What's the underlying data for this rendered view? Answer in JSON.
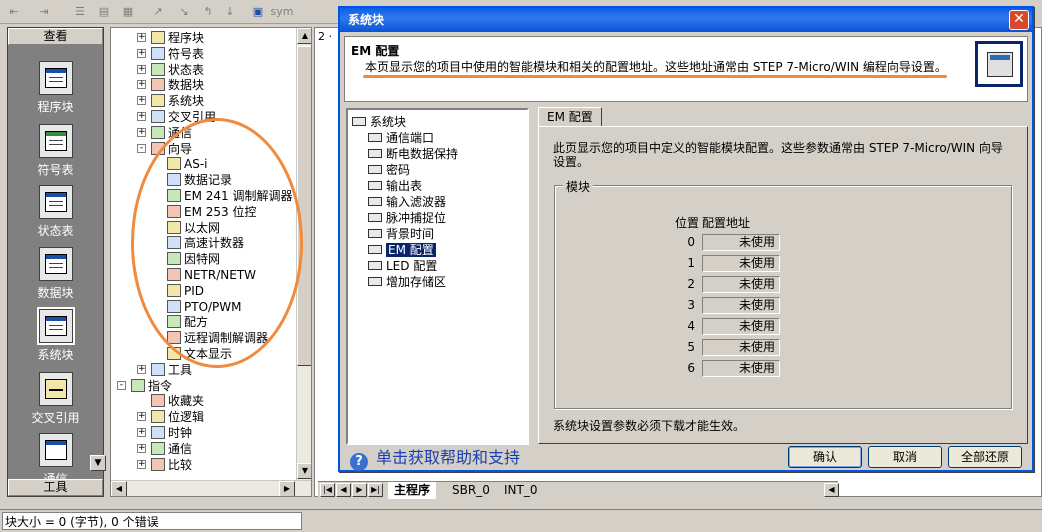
{
  "toolbar": {
    "icons": [
      "indent-icon",
      "outdent-icon",
      "list-icon",
      "table-icon",
      "grid-icon",
      "wire-icon",
      "wire2-icon",
      "arrow-icon",
      "monitor-icon",
      "sym-icon"
    ],
    "sym_label": "sym"
  },
  "viewbar": {
    "header": "查看",
    "footer": "工具",
    "items": [
      {
        "label": "程序块",
        "icon": "program-block-icon"
      },
      {
        "label": "符号表",
        "icon": "symbol-table-icon"
      },
      {
        "label": "状态表",
        "icon": "status-table-icon"
      },
      {
        "label": "数据块",
        "icon": "data-block-icon"
      },
      {
        "label": "系统块",
        "icon": "system-block-icon",
        "selected": true
      },
      {
        "label": "交叉引用",
        "icon": "cross-reference-icon"
      },
      {
        "label": "通信",
        "icon": "communication-icon"
      }
    ]
  },
  "tree": {
    "items": [
      {
        "label": "程序块",
        "level": 1,
        "expander": "+"
      },
      {
        "label": "符号表",
        "level": 1,
        "expander": "+"
      },
      {
        "label": "状态表",
        "level": 1,
        "expander": "+"
      },
      {
        "label": "数据块",
        "level": 1,
        "expander": "+"
      },
      {
        "label": "系统块",
        "level": 1,
        "expander": "+"
      },
      {
        "label": "交叉引用",
        "level": 1,
        "expander": "+"
      },
      {
        "label": "通信",
        "level": 1,
        "expander": "+"
      },
      {
        "label": "向导",
        "level": 1,
        "expander": "-"
      },
      {
        "label": "AS-i",
        "level": 2
      },
      {
        "label": "数据记录",
        "level": 2
      },
      {
        "label": "EM 241 调制解调器",
        "level": 2
      },
      {
        "label": "EM 253 位控",
        "level": 2
      },
      {
        "label": "以太网",
        "level": 2
      },
      {
        "label": "高速计数器",
        "level": 2
      },
      {
        "label": "因特网",
        "level": 2
      },
      {
        "label": "NETR/NETW",
        "level": 2
      },
      {
        "label": "PID",
        "level": 2
      },
      {
        "label": "PTO/PWM",
        "level": 2
      },
      {
        "label": "配方",
        "level": 2
      },
      {
        "label": "远程调制解调器",
        "level": 2
      },
      {
        "label": "文本显示",
        "level": 2
      },
      {
        "label": "工具",
        "level": 1,
        "expander": "+"
      },
      {
        "label": "指令",
        "level": 0,
        "expander": "-"
      },
      {
        "label": "收藏夹",
        "level": 1,
        "expander": ""
      },
      {
        "label": "位逻辑",
        "level": 1,
        "expander": "+"
      },
      {
        "label": "时钟",
        "level": 1,
        "expander": "+"
      },
      {
        "label": "通信",
        "level": 1,
        "expander": "+"
      },
      {
        "label": "比较",
        "level": 1,
        "expander": "+"
      }
    ]
  },
  "editor": {
    "tabs": [
      "主程序",
      "SBR_0",
      "INT_0"
    ],
    "ruler_label": "2 ·"
  },
  "status": {
    "text": "块大小 = 0 (字节), 0 个错误"
  },
  "dialog": {
    "title": "系统块",
    "close_glyph": "✕",
    "header_title": "EM 配置",
    "header_desc": "本页显示您的项目中使用的智能模块和相关的配置地址。这些地址通常由 STEP 7-Micro/WIN 编程向导设置。",
    "tree_root": "系统块",
    "tree_items": [
      "通信端口",
      "断电数据保持",
      "密码",
      "输出表",
      "输入滤波器",
      "脉冲捕捉位",
      "背景时间",
      "EM 配置",
      "LED 配置",
      "增加存储区"
    ],
    "selected_item": "EM 配置",
    "tab_label": "EM 配置",
    "panel_desc": "此页显示您的项目中定义的智能模块配置。这些参数通常由 STEP 7-Micro/WIN 向导设置。",
    "group_label": "模块",
    "col_position": "位置",
    "col_address": "配置地址",
    "modules": [
      {
        "position": "0",
        "address": "未使用"
      },
      {
        "position": "1",
        "address": "未使用"
      },
      {
        "position": "2",
        "address": "未使用"
      },
      {
        "position": "3",
        "address": "未使用"
      },
      {
        "position": "4",
        "address": "未使用"
      },
      {
        "position": "5",
        "address": "未使用"
      },
      {
        "position": "6",
        "address": "未使用"
      }
    ],
    "panel_footer": "系统块设置参数必须下载才能生效。",
    "help_text": "单击获取帮助和支持",
    "buttons": {
      "ok": "确认",
      "cancel": "取消",
      "restore": "全部还原"
    }
  },
  "colors": {
    "title_bar": "#0a5ee6",
    "selection": "#0a246a",
    "annotation": "#f08a3c",
    "help_link": "#1a3fb0"
  }
}
